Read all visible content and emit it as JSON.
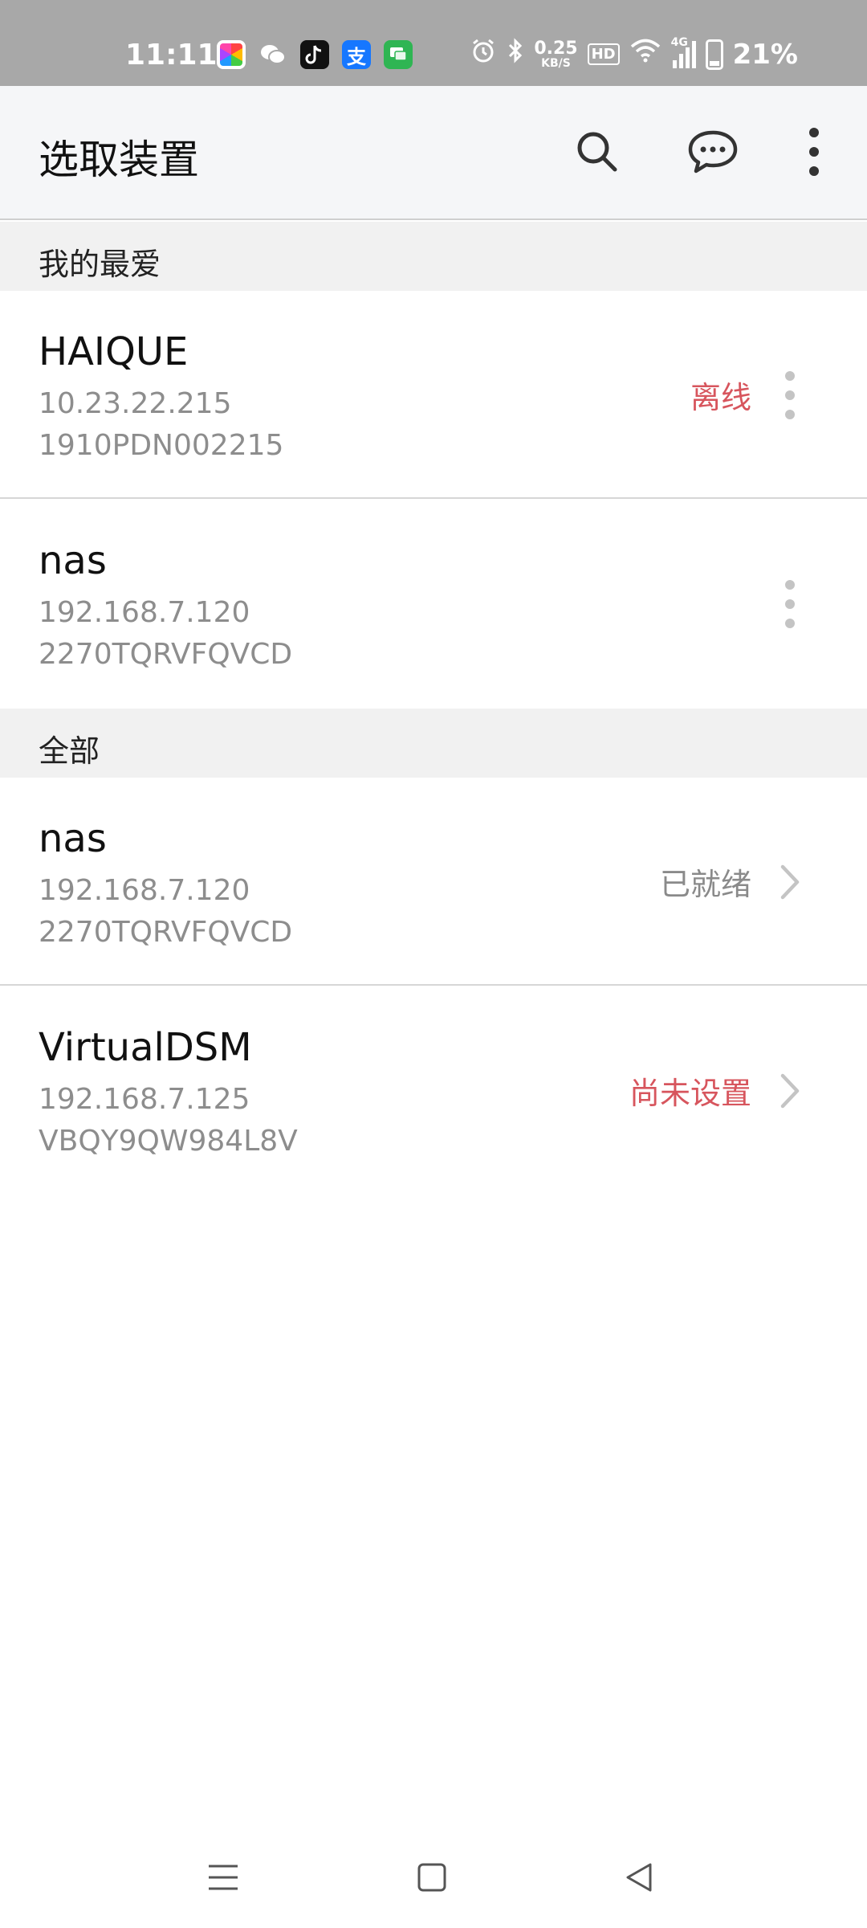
{
  "status_bar": {
    "time": "11:11",
    "speed_value": "0.25",
    "speed_unit": "KB/S",
    "hd_label": "HD",
    "network_label": "4G",
    "battery": "21%",
    "battery_level": 0.21,
    "apps": [
      {
        "icon": "photos-app-icon",
        "color": "#ffffff"
      },
      {
        "icon": "wechat-app-icon",
        "color": "#ffffff"
      },
      {
        "icon": "tiktok-app-icon",
        "color": "#111111"
      },
      {
        "icon": "alipay-app-icon",
        "color": "#1677ff"
      },
      {
        "icon": "messages-app-icon",
        "color": "#2fb553"
      }
    ]
  },
  "app_bar": {
    "title": "选取装置",
    "actions": [
      "search-icon",
      "chat-icon",
      "more-vert-icon"
    ]
  },
  "sections": [
    {
      "title": "我的最爱",
      "devices": [
        {
          "name": "HAIQUE",
          "ip": "10.23.22.215",
          "serial": "1910PDN002215",
          "status": "离线",
          "status_color": "#d7555d",
          "action": "more-vert-icon"
        },
        {
          "name": "nas",
          "ip": "192.168.7.120",
          "serial": "2270TQRVFQVCD",
          "status": "",
          "action": "more-vert-icon"
        }
      ]
    },
    {
      "title": "全部",
      "devices": [
        {
          "name": "nas",
          "ip": "192.168.7.120",
          "serial": "2270TQRVFQVCD",
          "status": "已就绪",
          "status_color": "#8a8a8a",
          "action": "chevron-right-icon"
        },
        {
          "name": "VirtualDSM",
          "ip": "192.168.7.125",
          "serial": "VBQY9QW984L8V",
          "status": "尚未设置",
          "status_color": "#d7555d",
          "action": "chevron-right-icon"
        }
      ]
    }
  ],
  "nav_bar": {
    "buttons": [
      "menu-icon",
      "home-icon",
      "back-icon"
    ]
  }
}
